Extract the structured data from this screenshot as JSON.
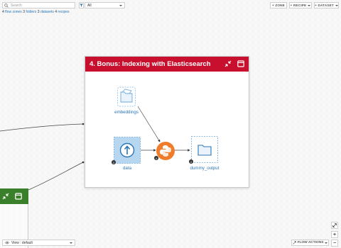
{
  "toolbar": {
    "search_placeholder": "Search",
    "filter_value": "All",
    "zone_btn": "+ ZONE",
    "recipe_btn": "+ RECIPE",
    "dataset_btn": "+ DATASET"
  },
  "summary": {
    "flow_zones_count": "4",
    "flow_zones_label": "flow zones",
    "folders_count": "3",
    "folders_label": "folders",
    "datasets_count": "3",
    "datasets_label": "datasets",
    "recipes_count": "4",
    "recipes_label": "recipes"
  },
  "zone": {
    "title": "4. Bonus: Indexing with Elasticsearch",
    "header_color": "#c8102e"
  },
  "nodes": {
    "embeddings_label": "embeddings",
    "data_label": "data",
    "output_label": "dummy_output",
    "info_glyph": "i"
  },
  "bottom": {
    "view_label": "View : default",
    "flow_actions": "FLOW ACTIONS",
    "zoom_in": "+",
    "zoom_out": "−"
  },
  "colors": {
    "accent": "#2a76b5",
    "node_blue": "#6aa8de",
    "python_orange": "#f07c2a",
    "zone2_green": "#3a7f2a"
  }
}
